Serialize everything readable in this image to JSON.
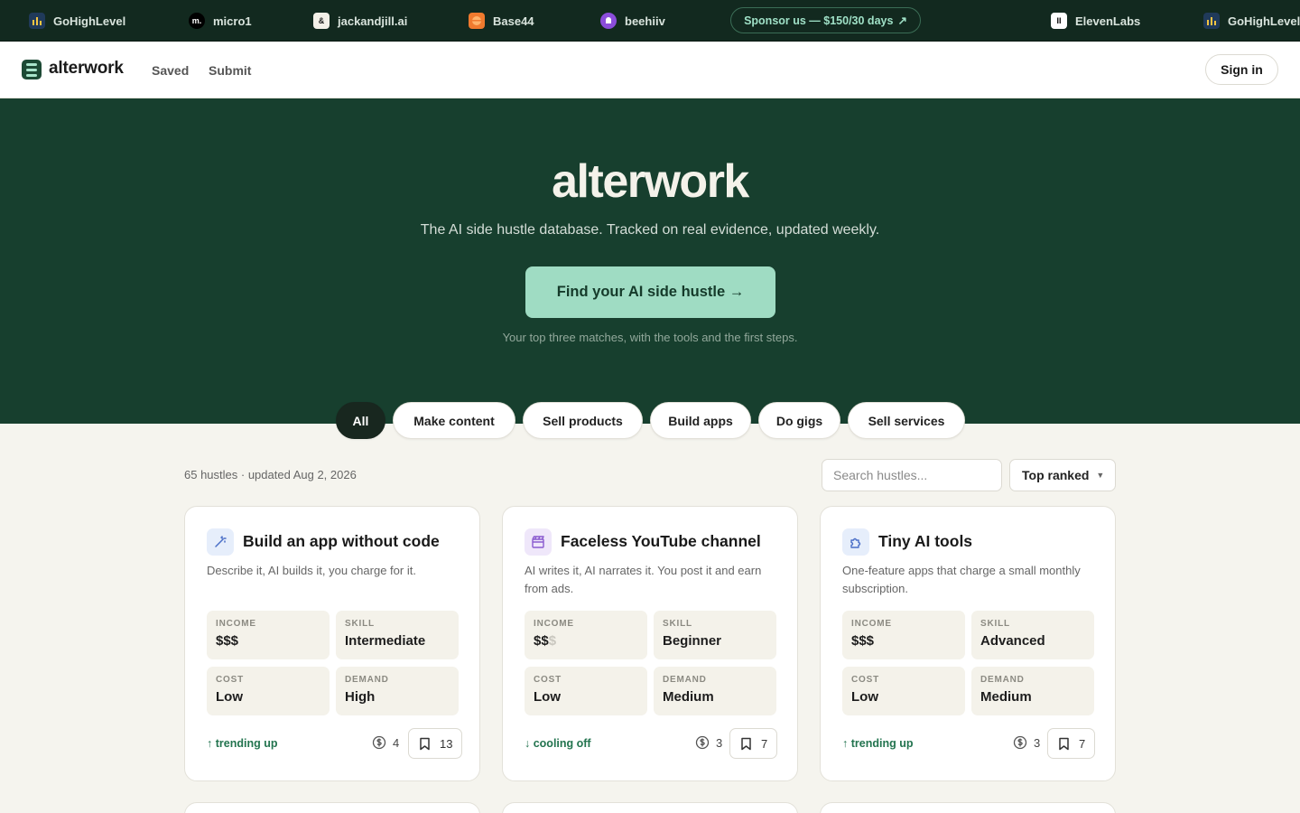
{
  "sponsors": [
    {
      "name": "GoHighLevel",
      "logo": "goh"
    },
    {
      "name": "micro1",
      "logo": "micro1"
    },
    {
      "name": "jackandjill.ai",
      "logo": "jj"
    },
    {
      "name": "Base44",
      "logo": "base44"
    },
    {
      "name": "beehiiv",
      "logo": "beehiiv"
    },
    {
      "name": "ElevenLabs",
      "logo": "eleven"
    },
    {
      "name": "GoHighLevel",
      "logo": "goh"
    }
  ],
  "sponsor_cta": "Sponsor us — $150/30 days",
  "nav": {
    "brand": "alterwork",
    "links": [
      "Saved",
      "Submit"
    ],
    "signin": "Sign in"
  },
  "hero": {
    "title": "alterwork",
    "subtitle": "The AI side hustle database. Tracked on real evidence, updated weekly.",
    "cta": "Find your AI side hustle →",
    "note": "Your top three matches, with the tools and the first steps."
  },
  "filters": [
    "All",
    "Make content",
    "Sell products",
    "Build apps",
    "Do gigs",
    "Sell services"
  ],
  "active_filter": "All",
  "listing": {
    "count_text": "65 hustles · updated Aug 2, 2026",
    "search_placeholder": "Search hustles...",
    "sort": "Top ranked"
  },
  "cards": [
    {
      "icon": "magic-wand-icon",
      "title": "Build an app without code",
      "desc": "Describe it, AI builds it, you charge for it.",
      "income": "$$$",
      "income_dim": "",
      "skill": "Intermediate",
      "cost": "Low",
      "demand": "High",
      "trend": "↑ trending up",
      "tools": "4",
      "saves": "13"
    },
    {
      "icon": "clapperboard-icon",
      "title": "Faceless YouTube channel",
      "desc": "AI writes it, AI narrates it. You post it and earn from ads.",
      "income": "$$",
      "income_dim": "$",
      "skill": "Beginner",
      "cost": "Low",
      "demand": "Medium",
      "trend": "↓ cooling off",
      "tools": "3",
      "saves": "7"
    },
    {
      "icon": "puzzle-icon",
      "title": "Tiny AI tools",
      "desc": "One-feature apps that charge a small monthly subscription.",
      "income": "$$$",
      "income_dim": "",
      "skill": "Advanced",
      "cost": "Low",
      "demand": "Medium",
      "trend": "↑ trending up",
      "tools": "3",
      "saves": "7"
    }
  ],
  "stat_labels": {
    "income": "INCOME",
    "skill": "SKILL",
    "cost": "COST",
    "demand": "DEMAND"
  },
  "colors": {
    "hero_bg": "#173f2e",
    "accent": "#9fdcc3",
    "trend": "#23744f"
  }
}
